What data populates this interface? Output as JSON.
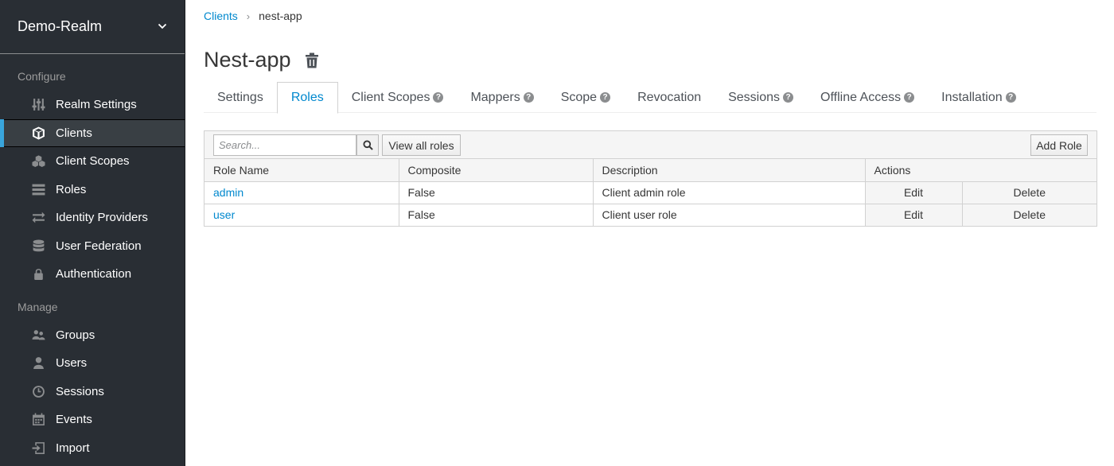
{
  "sidebar": {
    "realm": "Demo-Realm",
    "configure_label": "Configure",
    "configure_items": [
      {
        "label": "Realm Settings",
        "icon": "sliders-icon"
      },
      {
        "label": "Clients",
        "icon": "cube-icon",
        "active": true
      },
      {
        "label": "Client Scopes",
        "icon": "cubes-icon"
      },
      {
        "label": "Roles",
        "icon": "list-icon"
      },
      {
        "label": "Identity Providers",
        "icon": "exchange-icon"
      },
      {
        "label": "User Federation",
        "icon": "database-icon"
      },
      {
        "label": "Authentication",
        "icon": "lock-icon"
      }
    ],
    "manage_label": "Manage",
    "manage_items": [
      {
        "label": "Groups",
        "icon": "users-icon"
      },
      {
        "label": "Users",
        "icon": "user-icon"
      },
      {
        "label": "Sessions",
        "icon": "clock-icon"
      },
      {
        "label": "Events",
        "icon": "calendar-icon"
      },
      {
        "label": "Import",
        "icon": "import-icon"
      }
    ]
  },
  "breadcrumb": {
    "parent": "Clients",
    "separator": "›",
    "current": "nest-app"
  },
  "page_title": "Nest-app",
  "tabs": [
    {
      "label": "Settings",
      "help": false
    },
    {
      "label": "Roles",
      "help": false,
      "active": true
    },
    {
      "label": "Client Scopes",
      "help": true
    },
    {
      "label": "Mappers",
      "help": true
    },
    {
      "label": "Scope",
      "help": true
    },
    {
      "label": "Revocation",
      "help": false
    },
    {
      "label": "Sessions",
      "help": true
    },
    {
      "label": "Offline Access",
      "help": true
    },
    {
      "label": "Installation",
      "help": true
    }
  ],
  "help_glyph": "?",
  "toolbar": {
    "search_placeholder": "Search...",
    "view_all_label": "View all roles",
    "add_role_label": "Add Role"
  },
  "table": {
    "headers": {
      "role_name": "Role Name",
      "composite": "Composite",
      "description": "Description",
      "actions": "Actions"
    },
    "rows": [
      {
        "name": "admin",
        "composite": "False",
        "description": "Client admin role",
        "edit": "Edit",
        "delete": "Delete"
      },
      {
        "name": "user",
        "composite": "False",
        "description": "Client user role",
        "edit": "Edit",
        "delete": "Delete"
      }
    ]
  },
  "colors": {
    "sidebar_bg": "#292e34",
    "active_accent": "#39a5dc",
    "link": "#0088ce"
  }
}
